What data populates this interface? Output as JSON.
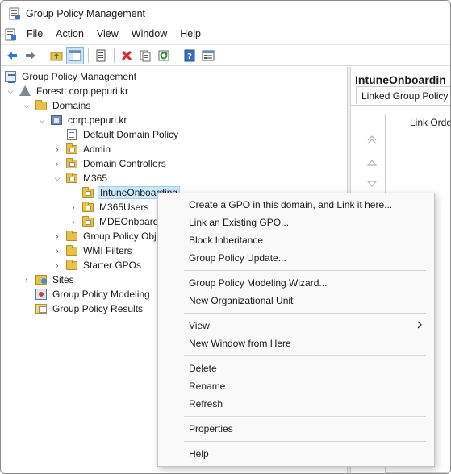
{
  "window": {
    "title": "Group Policy Management"
  },
  "menubar": {
    "items": [
      "File",
      "Action",
      "View",
      "Window",
      "Help"
    ]
  },
  "toolbar": {
    "buttons": [
      {
        "icon": "back-arrow-icon"
      },
      {
        "icon": "forward-arrow-icon"
      },
      {
        "icon": "up-folder-icon"
      },
      {
        "icon": "show-hide-tree-icon",
        "pressed": true
      },
      {
        "icon": "properties-icon"
      },
      {
        "icon": "delete-icon"
      },
      {
        "icon": "copy-icon"
      },
      {
        "icon": "refresh-icon"
      },
      {
        "icon": "help-icon"
      },
      {
        "icon": "mmc-view-icon"
      }
    ]
  },
  "tree": {
    "root": "Group Policy Management",
    "forest": "Forest: corp.pepuri.kr",
    "domains": "Domains",
    "domain": "corp.pepuri.kr",
    "default_policy": "Default Domain Policy",
    "admin": "Admin",
    "domain_controllers": "Domain Controllers",
    "m365": "M365",
    "intune": "IntuneOnboarding",
    "m365users": "M365Users",
    "mdeonboard": "MDEOnboard",
    "gpo_objects": "Group Policy Obj",
    "wmi_filters": "WMI Filters",
    "starter_gpos": "Starter GPOs",
    "sites": "Sites",
    "modeling": "Group Policy Modeling",
    "results": "Group Policy Results"
  },
  "right_pane": {
    "title": "IntuneOnboardin",
    "tab": "Linked Group Policy",
    "column_header": "Link Order"
  },
  "context_menu": {
    "create_gpo": "Create a GPO in this domain, and Link it here...",
    "link_existing": "Link an Existing GPO...",
    "block_inheritance": "Block Inheritance",
    "gp_update": "Group Policy Update...",
    "modeling_wizard": "Group Policy Modeling Wizard...",
    "new_ou": "New Organizational Unit",
    "view": "View",
    "new_window": "New Window from Here",
    "delete": "Delete",
    "rename": "Rename",
    "refresh": "Refresh",
    "properties": "Properties",
    "help": "Help"
  }
}
